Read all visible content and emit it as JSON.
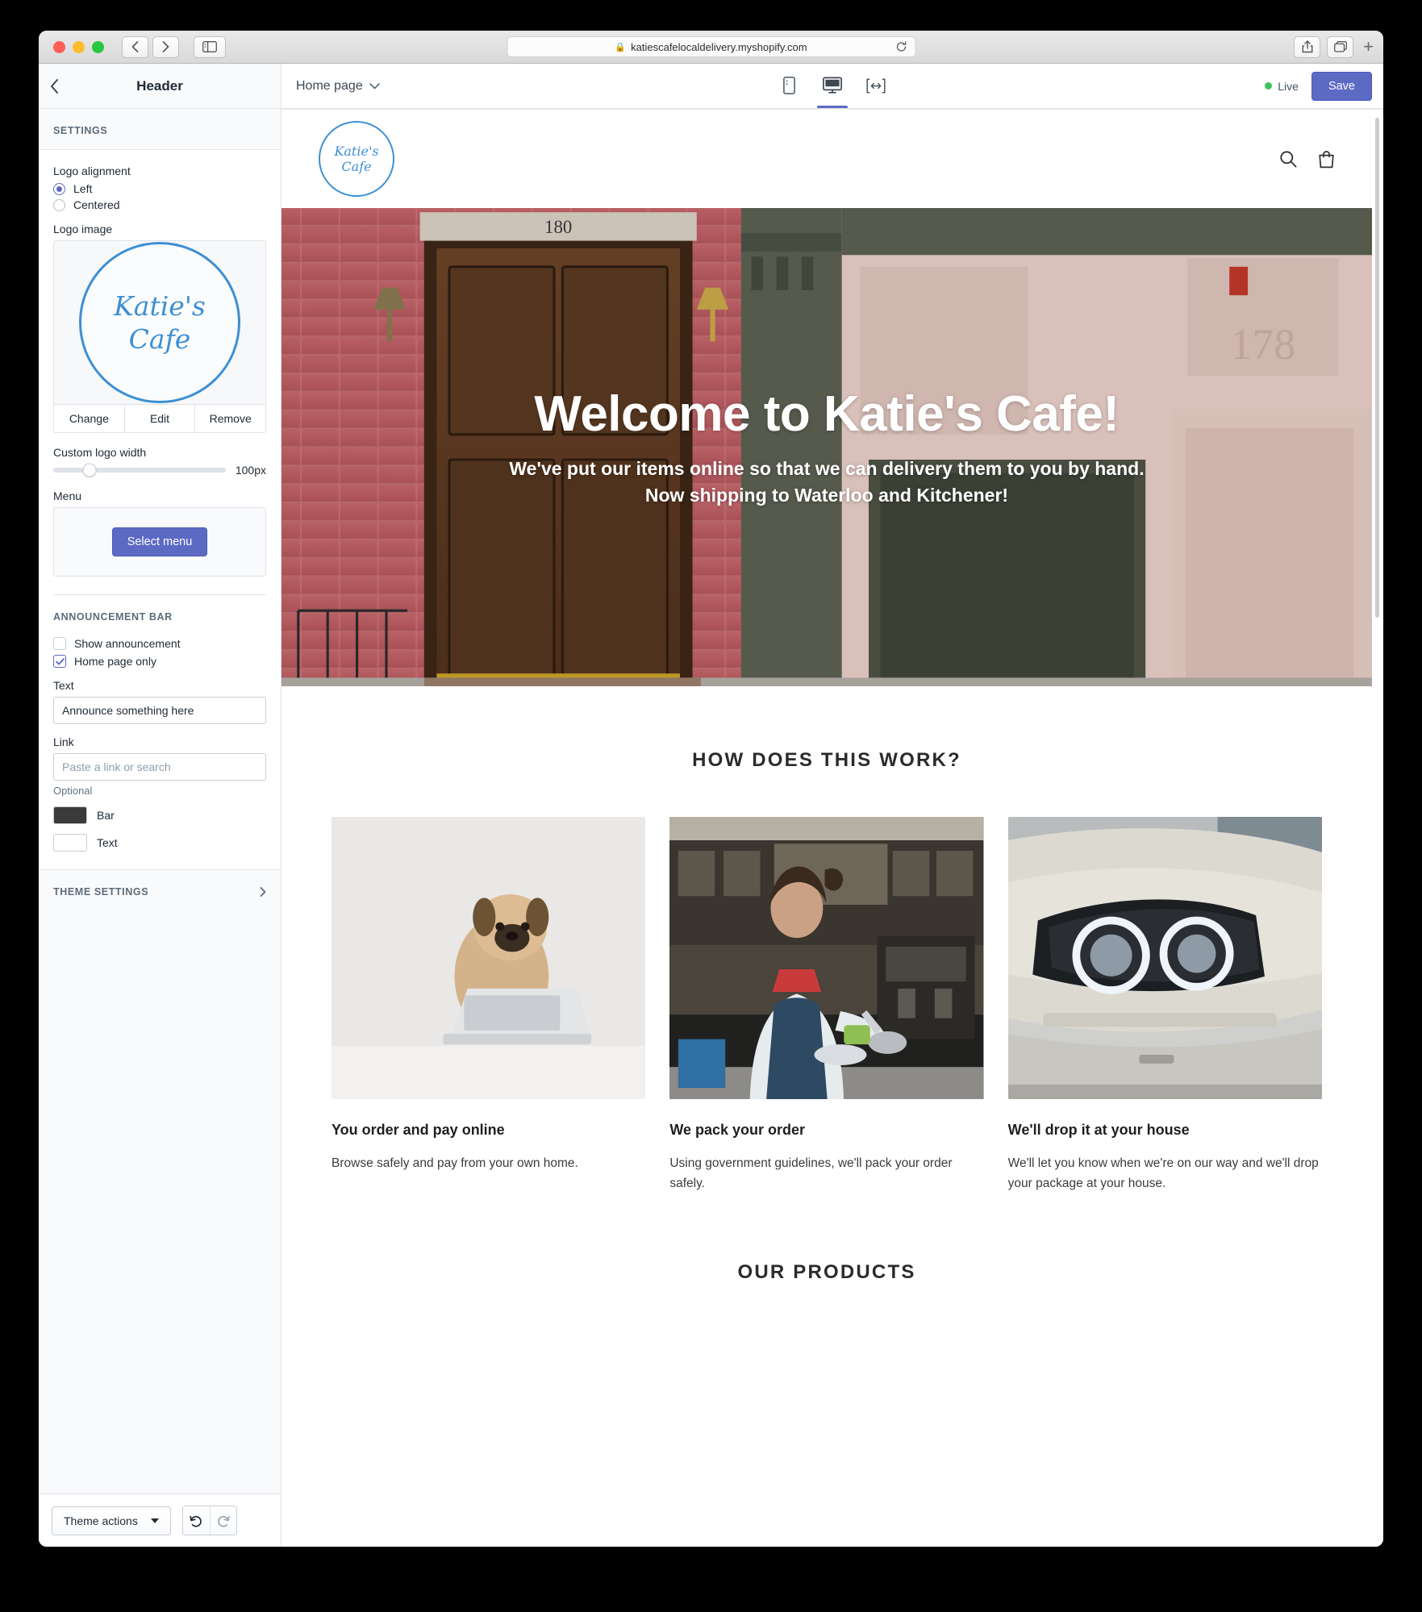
{
  "browser": {
    "url": "katiescafelocaldelivery.myshopify.com",
    "lock_icon": "lock-icon",
    "back_icon": "back-arrow-icon",
    "forward_icon": "forward-arrow-icon",
    "sidebar_icon": "sidebar-toggle-icon",
    "reload_icon": "reload-icon",
    "share_icon": "share-icon",
    "tabs_icon": "tab-overview-icon",
    "new_tab_icon": "plus-icon"
  },
  "sidebar": {
    "back_icon": "chevron-left-icon",
    "title": "Header",
    "settings_label": "SETTINGS",
    "logo_alignment": {
      "label": "Logo alignment",
      "options": [
        {
          "label": "Left",
          "selected": true
        },
        {
          "label": "Centered",
          "selected": false
        }
      ]
    },
    "logo_image": {
      "label": "Logo image",
      "logo_line1": "Katie's",
      "logo_line2": "Cafe",
      "actions": [
        "Change",
        "Edit",
        "Remove"
      ]
    },
    "custom_logo_width": {
      "label": "Custom logo width",
      "value": "100px",
      "percent": 21
    },
    "menu": {
      "label": "Menu",
      "button": "Select menu"
    },
    "announcement_bar": {
      "label": "ANNOUNCEMENT BAR",
      "checkboxes": [
        {
          "label": "Show announcement",
          "checked": false
        },
        {
          "label": "Home page only",
          "checked": true
        }
      ],
      "text_label": "Text",
      "text_value": "Announce something here",
      "link_label": "Link",
      "link_placeholder": "Paste a link or search",
      "link_help": "Optional",
      "swatches": [
        {
          "label": "Bar",
          "color": "#3b3b3b"
        },
        {
          "label": "Text",
          "color": "#ffffff"
        }
      ]
    },
    "theme_settings_label": "THEME SETTINGS",
    "theme_settings_chevron": "chevron-right-icon",
    "footer": {
      "theme_actions": "Theme actions",
      "undo_icon": "undo-icon",
      "redo_icon": "redo-icon"
    }
  },
  "topbar": {
    "page": "Home page",
    "page_chevron": "chevron-down-icon",
    "devices": [
      {
        "name": "mobile-preview",
        "icon": "mobile-icon",
        "active": false
      },
      {
        "name": "desktop-preview",
        "icon": "desktop-icon",
        "active": true
      },
      {
        "name": "fullwidth-preview",
        "icon": "fullwidth-icon",
        "active": false
      }
    ],
    "status": "Live",
    "status_color": "#3ec45f",
    "save_label": "Save",
    "save_color": "#5c6ac4"
  },
  "preview": {
    "store_header": {
      "logo_line1": "Katie's",
      "logo_line2": "Cafe",
      "search_icon": "search-icon",
      "cart_icon": "shopping-bag-icon"
    },
    "hero": {
      "title": "Welcome to Katie's Cafe!",
      "subtitle": "We've put our items online so that we can delivery them to you by hand. Now shipping to Waterloo and Kitchener!"
    },
    "how_section": {
      "title": "HOW DOES THIS WORK?",
      "cards": [
        {
          "image": "dog-at-laptop-photo",
          "title": "You order and pay online",
          "body": "Browse safely and pay from your own home."
        },
        {
          "image": "barista-pouring-coffee-photo",
          "title": "We pack your order",
          "body": "Using government guidelines, we'll pack your order safely."
        },
        {
          "image": "car-headlight-photo",
          "title": "We'll drop it at your house",
          "body": "We'll let you know when we're on our way and we'll drop your package at your house."
        }
      ]
    },
    "products_title": "OUR PRODUCTS"
  }
}
